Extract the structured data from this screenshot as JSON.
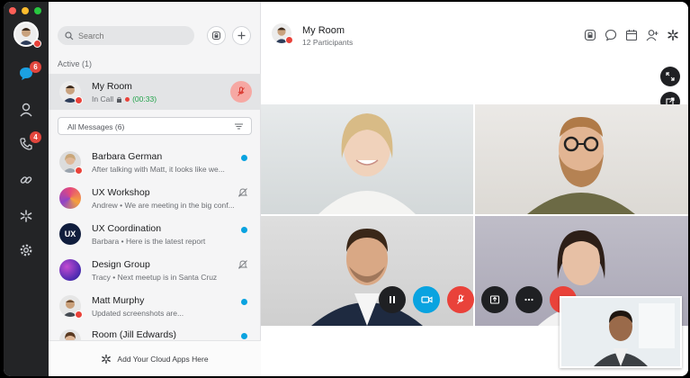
{
  "sidebar": {
    "search_placeholder": "Search",
    "active_label": "Active (1)",
    "active_item": {
      "name": "My Room",
      "status": "In Call",
      "timer": "(00:33)"
    },
    "filter_label": "All Messages (6)",
    "items": [
      {
        "name": "Barbara German",
        "preview": "After talking with Matt, it looks like we...",
        "unread": true
      },
      {
        "name": "UX Workshop",
        "preview": "Andrew • We are meeting in the big conf...",
        "muted": true
      },
      {
        "name": "UX Coordination",
        "preview": "Barbara • Here is the latest report",
        "unread": true,
        "initials": "UX"
      },
      {
        "name": "Design Group",
        "preview": "Tracy • Next meetup is in Santa Cruz",
        "muted": true
      },
      {
        "name": "Matt Murphy",
        "preview": "Updated screenshots are...",
        "unread": true
      },
      {
        "name": "Room (Jill Edwards)",
        "preview": "",
        "unread": true
      }
    ],
    "footer_label": "Add Your Cloud Apps Here"
  },
  "rail": {
    "messages_badge": "6",
    "calls_badge": "4"
  },
  "header": {
    "title": "My Room",
    "participants": "12 Participants"
  },
  "colors": {
    "accent": "#09a3e0",
    "danger": "#e9423a",
    "mute": "#f6a8a3"
  }
}
